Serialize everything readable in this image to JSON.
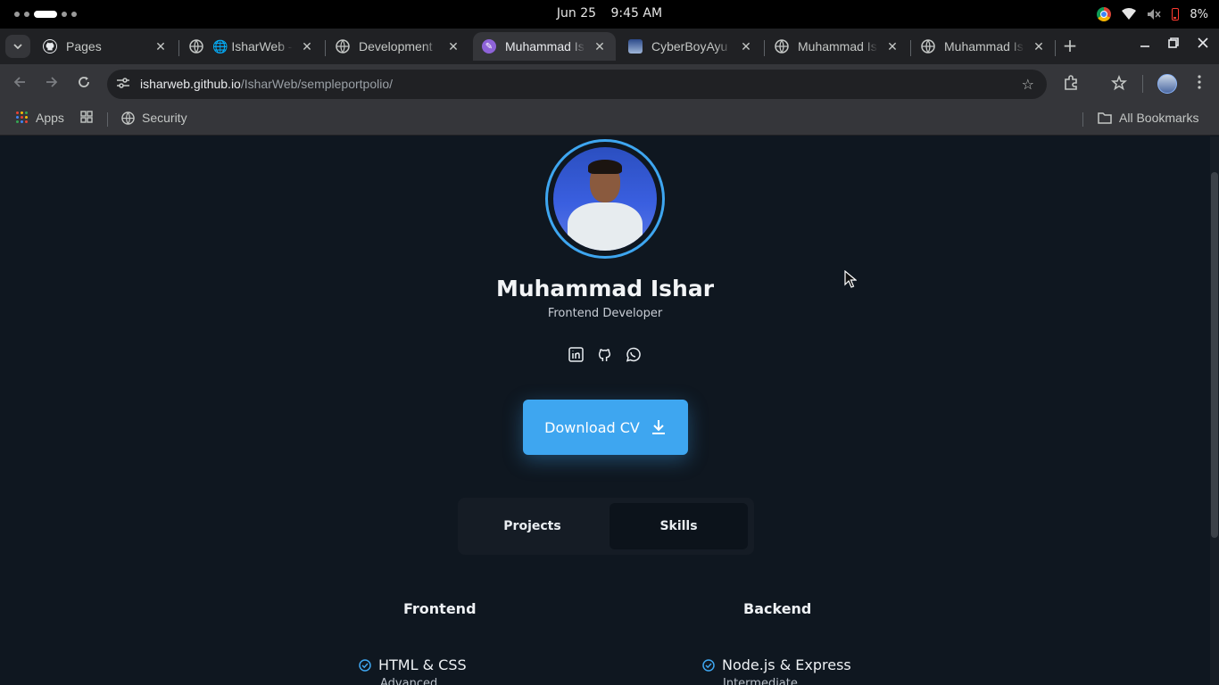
{
  "os": {
    "date": "Jun 25",
    "time": "9:45 AM",
    "battery": "8%"
  },
  "tabs": [
    {
      "title": "Pages",
      "favicon": "github-icon"
    },
    {
      "title": "🌐 IsharWeb - r",
      "favicon": "globe-icon"
    },
    {
      "title": "Development",
      "favicon": "globe-icon"
    },
    {
      "title": "Muhammad Is",
      "favicon": "portfolio-icon",
      "active": true
    },
    {
      "title": "CyberBoyAyu",
      "favicon": "avatar-icon"
    },
    {
      "title": "Muhammad Is",
      "favicon": "globe-icon"
    },
    {
      "title": "Muhammad Is",
      "favicon": "globe-icon"
    }
  ],
  "address_bar": {
    "domain": "isharweb.github.io",
    "path": "/IsharWeb/sempleportpolio/"
  },
  "bookmarks": {
    "apps_label": "Apps",
    "security_label": "Security",
    "all_bookmarks_label": "All Bookmarks"
  },
  "profile": {
    "name": "Muhammad Ishar",
    "role": "Frontend Developer",
    "socials": [
      "linkedin-icon",
      "github-icon",
      "whatsapp-icon"
    ],
    "cv_button": "Download CV"
  },
  "section_tabs": [
    {
      "label": "Projects",
      "selected": false
    },
    {
      "label": "Skills",
      "selected": true
    }
  ],
  "skills": {
    "frontend": {
      "title": "Frontend",
      "first_skill": "HTML & CSS",
      "first_level": "Advanced"
    },
    "backend": {
      "title": "Backend",
      "first_skill": "Node.js & Express",
      "first_level": "Intermediate"
    }
  },
  "colors": {
    "accent": "#3ea6f0",
    "page_bg": "#0f1720",
    "tab_bg": "#151c25"
  }
}
